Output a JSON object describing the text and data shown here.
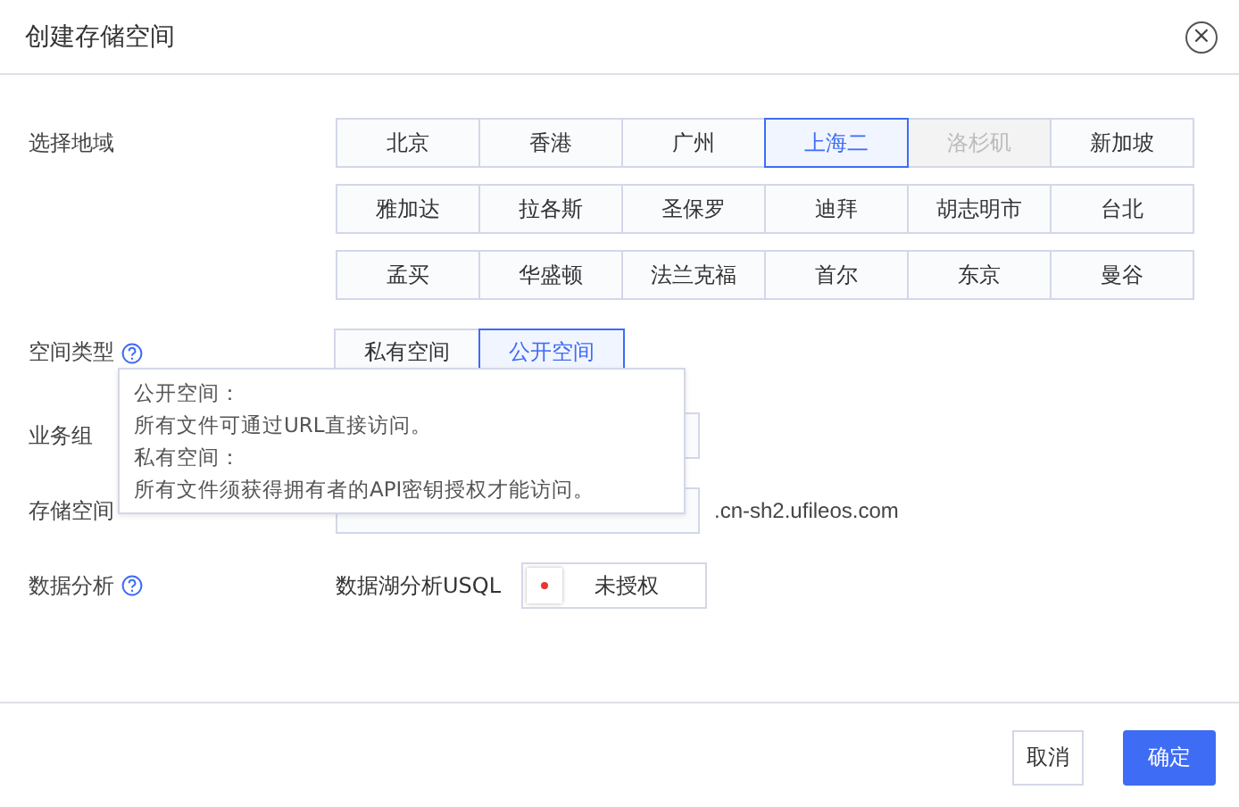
{
  "window": {
    "title": "创建存储空间",
    "close": "×"
  },
  "region": {
    "label": "选择地域",
    "rows": [
      [
        {
          "label": "北京",
          "selected": false,
          "disabled": false
        },
        {
          "label": "香港",
          "selected": false,
          "disabled": false
        },
        {
          "label": "广州",
          "selected": false,
          "disabled": false
        },
        {
          "label": "上海二",
          "selected": true,
          "disabled": false
        },
        {
          "label": "洛杉矶",
          "selected": false,
          "disabled": true
        },
        {
          "label": "新加坡",
          "selected": false,
          "disabled": false
        }
      ],
      [
        {
          "label": "雅加达",
          "selected": false,
          "disabled": false
        },
        {
          "label": "拉各斯",
          "selected": false,
          "disabled": false
        },
        {
          "label": "圣保罗",
          "selected": false,
          "disabled": false
        },
        {
          "label": "迪拜",
          "selected": false,
          "disabled": false
        },
        {
          "label": "胡志明市",
          "selected": false,
          "disabled": false
        },
        {
          "label": "台北",
          "selected": false,
          "disabled": false
        }
      ],
      [
        {
          "label": "孟买",
          "selected": false,
          "disabled": false
        },
        {
          "label": "华盛顿",
          "selected": false,
          "disabled": false
        },
        {
          "label": "法兰克福",
          "selected": false,
          "disabled": false
        },
        {
          "label": "首尔",
          "selected": false,
          "disabled": false
        },
        {
          "label": "东京",
          "selected": false,
          "disabled": false
        },
        {
          "label": "曼谷",
          "selected": false,
          "disabled": false
        }
      ]
    ]
  },
  "space_type": {
    "label": "空间类型",
    "options": [
      {
        "label": "私有空间",
        "selected": false
      },
      {
        "label": "公开空间",
        "selected": true
      }
    ],
    "tooltip": [
      "公开空间：",
      "所有文件可通过URL直接访问。",
      "私有空间：",
      "所有文件须获得拥有者的API密钥授权才能访问。"
    ]
  },
  "business_group": {
    "label": "业务组"
  },
  "domain": {
    "label": "存储空间",
    "suffix": ".cn-sh2.ufileos.com"
  },
  "analysis": {
    "label": "数据分析",
    "name": "数据湖分析USQL",
    "switch": {
      "on": false,
      "text": "未授权"
    }
  },
  "buttons": [
    {
      "label": "取消",
      "kind": "secondary"
    },
    {
      "label": "确定",
      "kind": "primary"
    }
  ]
}
